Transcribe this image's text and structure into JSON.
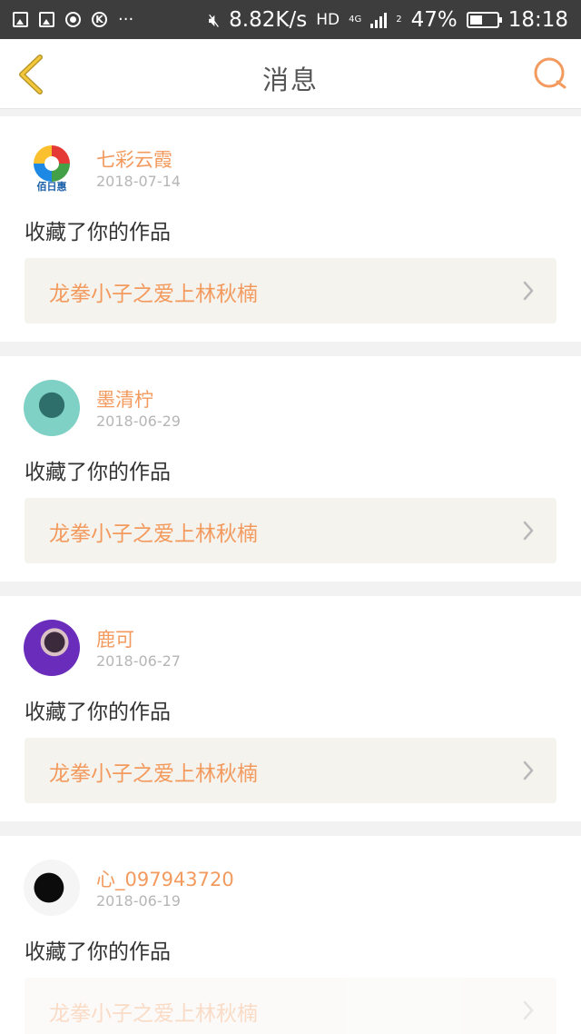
{
  "status_bar": {
    "speed": "8.82K/s",
    "hd": "HD",
    "network": "4G",
    "sim": "2",
    "battery_percent": "47%",
    "battery_level": 0.47,
    "time": "18:18"
  },
  "header": {
    "title": "消息",
    "back_icon": "chevron-left-icon",
    "search_icon": "search-icon"
  },
  "colors": {
    "accent": "#f39a5e",
    "back_icon": "#b9952a"
  },
  "messages": [
    {
      "user": "七彩云霞",
      "date": "2018-07-14",
      "action": "收藏了你的作品",
      "work_title": "龙拳小子之爱上林秋楠",
      "avatar_logo_text": "佰日惠"
    },
    {
      "user": "墨清柠",
      "date": "2018-06-29",
      "action": "收藏了你的作品",
      "work_title": "龙拳小子之爱上林秋楠"
    },
    {
      "user": "鹿可",
      "date": "2018-06-27",
      "action": "收藏了你的作品",
      "work_title": "龙拳小子之爱上林秋楠"
    },
    {
      "user": "心_097943720",
      "date": "2018-06-19",
      "action": "收藏了你的作品",
      "work_title": "龙拳小子之爱上林秋楠"
    }
  ]
}
